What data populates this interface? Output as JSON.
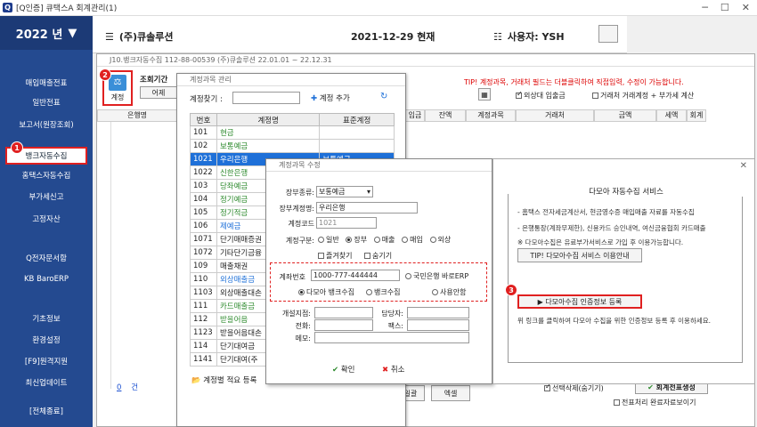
{
  "titlebar": {
    "title": "[Q인증] 큐택스A   회계관리(1)"
  },
  "sidebar": {
    "year": "2022 년",
    "items": [
      {
        "label": "매입매출전표"
      },
      {
        "label": "일반전표"
      },
      {
        "label": "보고서(원장조회)"
      },
      {
        "label": "뱅크자동수집"
      },
      {
        "label": "홈택스자동수집"
      },
      {
        "label": "부가세신고"
      },
      {
        "label": "고정자산"
      },
      {
        "label": "Q전자문서함"
      },
      {
        "label": "KB BaroERP"
      },
      {
        "label": "기초정보"
      },
      {
        "label": "환경설정"
      },
      {
        "label": "[F9]원격지원"
      },
      {
        "label": "최신업데이트"
      },
      {
        "label": "[전체종료]"
      }
    ],
    "badge1": "1"
  },
  "header": {
    "company": "(주)큐솔루션",
    "date": "2021-12-29 현재",
    "user": "사용자: YSH"
  },
  "bank": {
    "window_title": "J10.뱅크자동수집   112-88-00539  (주)큐솔루션 22.01.01 ~ 22.12.31",
    "badge2": "2",
    "icon_label": "계정",
    "period_label": "조회기간",
    "view_btn": "어제",
    "tip": "TIP! 계정과목, 거래처 필드는 더블클릭하여 직접입력, 수정이 가능합니다.",
    "chk_fx": "외상대 입출금",
    "chk_vat": "거래처 거래계정 + 부가세 계산",
    "columns_left": [
      "은행명"
    ],
    "columns": [
      "입금",
      "잔액",
      "계정과목",
      "거래처",
      "금액",
      "세액",
      "회계"
    ],
    "footer_count": "0",
    "footer_unit": "건",
    "btn_excel": "엑셀",
    "btn_del_prefix": "일괄",
    "chk_select_delete": "선택삭제(숨기기)",
    "btn_create": "회계전표생성",
    "chk_show_done": "전표처리 완료자료보이기"
  },
  "acct": {
    "window_title": "계정과목 관리",
    "search_label": "계정찾기 :",
    "add_btn": "계정 추가",
    "columns": [
      "번호",
      "계정명",
      "표준계정"
    ],
    "rows": [
      {
        "no": "101",
        "name": "현금",
        "std": "",
        "green": true
      },
      {
        "no": "102",
        "name": "보통예금",
        "std": "",
        "green": true
      },
      {
        "no": "1021",
        "name": "우리은행",
        "std": "보통예금",
        "green": false,
        "sel": true
      },
      {
        "no": "1022",
        "name": "신한은행",
        "std": "",
        "green": true
      },
      {
        "no": "103",
        "name": "당좌예금",
        "std": "",
        "green": true
      },
      {
        "no": "104",
        "name": "정기예금",
        "std": "",
        "green": true
      },
      {
        "no": "105",
        "name": "정기적금",
        "std": "",
        "green": true
      },
      {
        "no": "106",
        "name": "제예금",
        "std": "",
        "blue": true
      },
      {
        "no": "1071",
        "name": "단기매매증권",
        "std": "",
        "green": false
      },
      {
        "no": "1072",
        "name": "기타단기금융",
        "std": "",
        "green": false
      },
      {
        "no": "109",
        "name": "매출채권",
        "std": "",
        "green": false
      },
      {
        "no": "110",
        "name": "외상매출금",
        "std": "",
        "blue": true
      },
      {
        "no": "1103",
        "name": "외상매출대손",
        "std": "",
        "green": false
      },
      {
        "no": "111",
        "name": "카드매출금",
        "std": "",
        "green": true
      },
      {
        "no": "112",
        "name": "받을어음",
        "std": "",
        "green": true
      },
      {
        "no": "1123",
        "name": "받을어음대손",
        "std": "",
        "green": false
      },
      {
        "no": "114",
        "name": "단기대여금",
        "std": "",
        "green": false
      },
      {
        "no": "1141",
        "name": "단기대여(주",
        "std": "",
        "green": false
      }
    ],
    "footer": "계정별 적요 등록"
  },
  "edit": {
    "window_title": "계정과목 수정",
    "type_label": "장부종류:",
    "type_value": "보통예금",
    "name_label": "장부계정명:",
    "name_value": "우리은행",
    "code_label": "계정코드",
    "code_value": "1021",
    "kind_label": "계정구분:",
    "kinds": [
      "일반",
      "장부",
      "매출",
      "매입",
      "외상"
    ],
    "fav": "즐겨찾기",
    "hide": "숨기기",
    "acct_no_label": "계좌번호",
    "acct_no_value": "1000-777-444444",
    "kb_radio": "국민은행 바로ERP",
    "opt1": "다모아 뱅크수집",
    "opt2": "뱅크수집",
    "opt3": "사용안함",
    "open_label": "개설지점:",
    "manager_label": "담당자:",
    "phone_label": "전화:",
    "fax_label": "팩스:",
    "memo_label": "메모:",
    "ok": "확인",
    "cancel": "취소"
  },
  "svc": {
    "title": "다모아 자동수집 서비스",
    "line1": "- 홈택스 전자세금계산서, 현금영수증 매입매출 자료를 자동수집",
    "line2": "- 은행통장(계좌무제한), 신용카드 승인내역, 여신금융협회 카드매출",
    "line3": "※ 다모아수집은 유료부가서비스로 가입 후 이용가능합니다.",
    "tip_btn": "TIP! 다모아수집 서비스 이용안내",
    "badge3": "3",
    "reg_btn": "▶ 다모아수집 인증정보 등록",
    "note": "위 링크를 클릭하여 다모아 수집을 위한 인증정보 등록 후 이용하세요."
  },
  "colors": {
    "sidebar": "#244a90",
    "highlight": "#e02020",
    "select": "#1e70d8",
    "green": "#2d8a2d"
  }
}
